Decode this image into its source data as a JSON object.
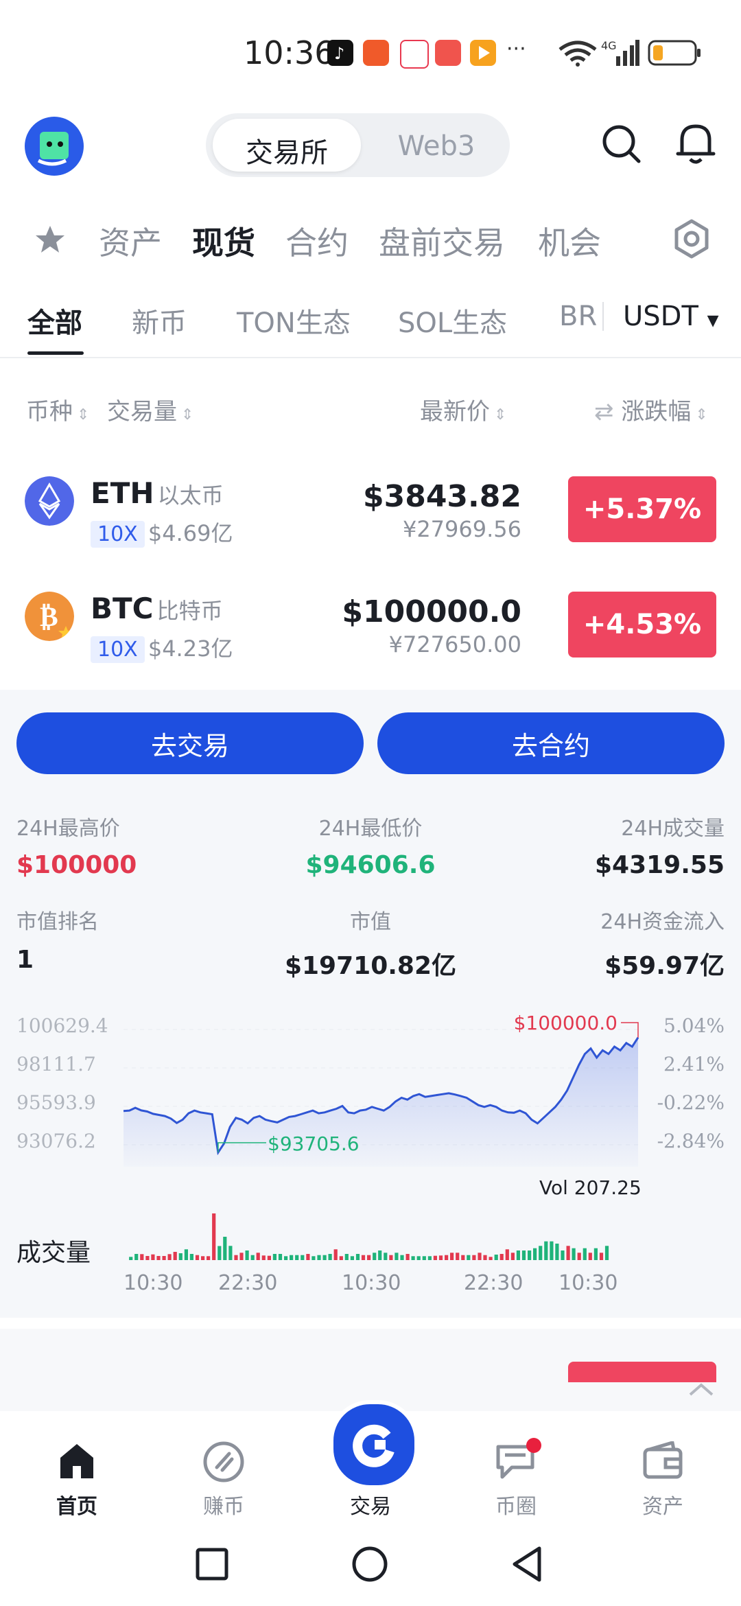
{
  "status_bar": {
    "time": "10:36",
    "dots": "···"
  },
  "header": {
    "segments": [
      "交易所",
      "Web3"
    ],
    "active_segment": "交易所"
  },
  "categories": [
    "资产",
    "现货",
    "合约",
    "盘前交易",
    "机会"
  ],
  "active_category": "现货",
  "subtabs": [
    "全部",
    "新币",
    "TON生态",
    "SOL生态",
    "BR"
  ],
  "active_subtab": "全部",
  "quote_currency": "USDT",
  "columns": {
    "coin": "币种",
    "volume": "交易量",
    "last_price": "最新价",
    "change": "涨跌幅"
  },
  "rows": [
    {
      "symbol": "ETH",
      "name": "以太币",
      "leverage": "10X",
      "volume": "$4.69亿",
      "price": "$3843.82",
      "price_cny": "¥27969.56",
      "change": "+5.37%"
    },
    {
      "symbol": "BTC",
      "name": "比特币",
      "leverage": "10X",
      "volume": "$4.23亿",
      "price": "$100000.0",
      "price_cny": "¥727650.00",
      "change": "+4.53%"
    }
  ],
  "detail": {
    "trade_button": "去交易",
    "contract_button": "去合约",
    "stats": [
      {
        "label": "24H最高价",
        "value": "$100000"
      },
      {
        "label": "24H最低价",
        "value": "$94606.6"
      },
      {
        "label": "24H成交量",
        "value": "$4319.55"
      },
      {
        "label": "市值排名",
        "value": "1"
      },
      {
        "label": "市值",
        "value": "$19710.82亿"
      },
      {
        "label": "24H资金流入",
        "value": "$59.97亿"
      }
    ],
    "y_axis_left": [
      "100629.4",
      "98111.7",
      "95593.9",
      "93076.2"
    ],
    "y_axis_right": [
      "5.04%",
      "2.41%",
      "-0.22%",
      "-2.84%"
    ],
    "high_marker": "$100000.0",
    "low_marker": "$93705.6",
    "vol_label": "Vol 207.25",
    "volume_title": "成交量",
    "time_labels": [
      "10:30",
      "22:30",
      "10:30",
      "22:30",
      "10:30"
    ]
  },
  "chart_data": {
    "type": "line",
    "ylim": [
      93076.2,
      100629.4
    ],
    "prices": [
      95980,
      96000,
      96150,
      96010,
      95950,
      95820,
      95760,
      95700,
      95560,
      95320,
      95500,
      95850,
      96000,
      95900,
      95850,
      95800,
      93705.6,
      94200,
      95100,
      95600,
      95500,
      95300,
      95600,
      95700,
      95500,
      95420,
      95350,
      95500,
      95650,
      95700,
      95800,
      95900,
      96000,
      95850,
      95900,
      96000,
      96100,
      96250,
      95900,
      95850,
      96000,
      96050,
      96200,
      96100,
      96000,
      96200,
      96500,
      96700,
      96600,
      96800,
      96900,
      96750,
      96800,
      96850,
      96900,
      96950,
      96880,
      96800,
      96700,
      96500,
      96300,
      96200,
      96300,
      96200,
      96000,
      95900,
      95880,
      96000,
      95850,
      95500,
      95300,
      95600,
      95900,
      96200,
      96600,
      97100,
      97800,
      98500,
      99100,
      99400,
      98900,
      99300,
      99100,
      99500,
      99300,
      99700,
      99500,
      100000
    ],
    "volume_colors": {
      "up": "#1fb37a",
      "down": "#e2394f"
    }
  },
  "bottom_nav": {
    "items": [
      "首页",
      "赚币",
      "交易",
      "币圈",
      "资产"
    ],
    "active": "首页"
  }
}
